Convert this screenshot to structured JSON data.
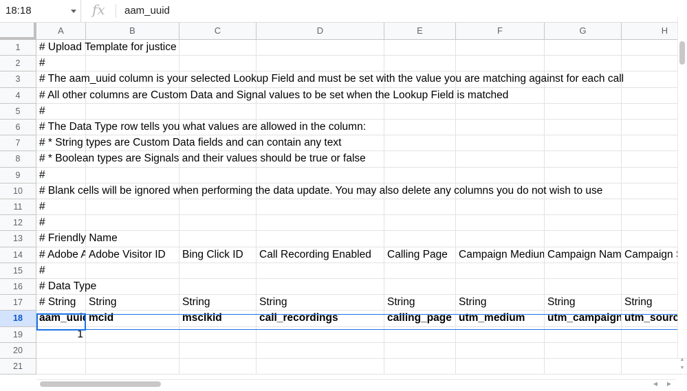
{
  "formula_bar": {
    "name_box": "18:18",
    "fx_label": "fx",
    "formula": "aam_uuid"
  },
  "columns": [
    "A",
    "B",
    "C",
    "D",
    "E",
    "F",
    "G",
    "H"
  ],
  "rows": [
    "1",
    "2",
    "3",
    "4",
    "5",
    "6",
    "7",
    "8",
    "9",
    "10",
    "11",
    "12",
    "13",
    "14",
    "15",
    "16",
    "17",
    "18",
    "19",
    "20",
    "21"
  ],
  "active_row": "18",
  "cells": [
    {
      "r": 1,
      "c": 0,
      "text": "# Upload Template for justice"
    },
    {
      "r": 2,
      "c": 0,
      "text": "#"
    },
    {
      "r": 3,
      "c": 0,
      "text": "# The aam_uuid column is your selected Lookup Field and must be set with the value you are matching against for each call"
    },
    {
      "r": 4,
      "c": 0,
      "text": "# All other columns are Custom Data and Signal values to be set when the Lookup Field is matched"
    },
    {
      "r": 5,
      "c": 0,
      "text": "#"
    },
    {
      "r": 6,
      "c": 0,
      "text": "# The Data Type row tells you what values are allowed in the column:"
    },
    {
      "r": 7,
      "c": 0,
      "text": "#   * String types are Custom Data fields and can contain any text"
    },
    {
      "r": 8,
      "c": 0,
      "text": "#   * Boolean types are Signals and their values should be true or false"
    },
    {
      "r": 9,
      "c": 0,
      "text": "#"
    },
    {
      "r": 10,
      "c": 0,
      "text": "# Blank cells will be ignored when performing the data update. You may also delete any columns you do not wish to use"
    },
    {
      "r": 11,
      "c": 0,
      "text": "#"
    },
    {
      "r": 12,
      "c": 0,
      "text": "#"
    },
    {
      "r": 13,
      "c": 0,
      "text": "# Friendly Name"
    },
    {
      "r": 14,
      "c": 0,
      "text": "# Adobe Audience Manager UUID",
      "clip": true
    },
    {
      "r": 14,
      "c": 1,
      "text": "Adobe Visitor ID"
    },
    {
      "r": 14,
      "c": 2,
      "text": "Bing Click ID"
    },
    {
      "r": 14,
      "c": 3,
      "text": "Call Recording Enabled"
    },
    {
      "r": 14,
      "c": 4,
      "text": "Calling Page"
    },
    {
      "r": 14,
      "c": 5,
      "text": "Campaign Medium",
      "clip": true
    },
    {
      "r": 14,
      "c": 6,
      "text": "Campaign Name",
      "clip": true
    },
    {
      "r": 14,
      "c": 7,
      "text": "Campaign Source",
      "clip": true
    },
    {
      "r": 15,
      "c": 0,
      "text": "#"
    },
    {
      "r": 16,
      "c": 0,
      "text": "# Data Type"
    },
    {
      "r": 17,
      "c": 0,
      "text": "# String"
    },
    {
      "r": 17,
      "c": 1,
      "text": "String"
    },
    {
      "r": 17,
      "c": 2,
      "text": "String"
    },
    {
      "r": 17,
      "c": 3,
      "text": "String"
    },
    {
      "r": 17,
      "c": 4,
      "text": "String"
    },
    {
      "r": 17,
      "c": 5,
      "text": "String"
    },
    {
      "r": 17,
      "c": 6,
      "text": "String"
    },
    {
      "r": 17,
      "c": 7,
      "text": "String"
    },
    {
      "r": 18,
      "c": 0,
      "text": "aam_uuid",
      "clip": true,
      "bold": true
    },
    {
      "r": 18,
      "c": 1,
      "text": "mcid",
      "bold": true
    },
    {
      "r": 18,
      "c": 2,
      "text": "msclkid",
      "bold": true
    },
    {
      "r": 18,
      "c": 3,
      "text": "call_recordings",
      "bold": true
    },
    {
      "r": 18,
      "c": 4,
      "text": "calling_page",
      "bold": true
    },
    {
      "r": 18,
      "c": 5,
      "text": "utm_medium",
      "bold": true
    },
    {
      "r": 18,
      "c": 6,
      "text": "utm_campaign",
      "clip": true,
      "bold": true
    },
    {
      "r": 18,
      "c": 7,
      "text": "utm_source",
      "clip": true,
      "bold": true
    },
    {
      "r": 19,
      "c": 0,
      "text": "1",
      "align": "right"
    }
  ],
  "colors": {
    "selection": "#1a73e8",
    "header_bg": "#f8f9fa",
    "active_header_bg": "#d3e3fd"
  }
}
